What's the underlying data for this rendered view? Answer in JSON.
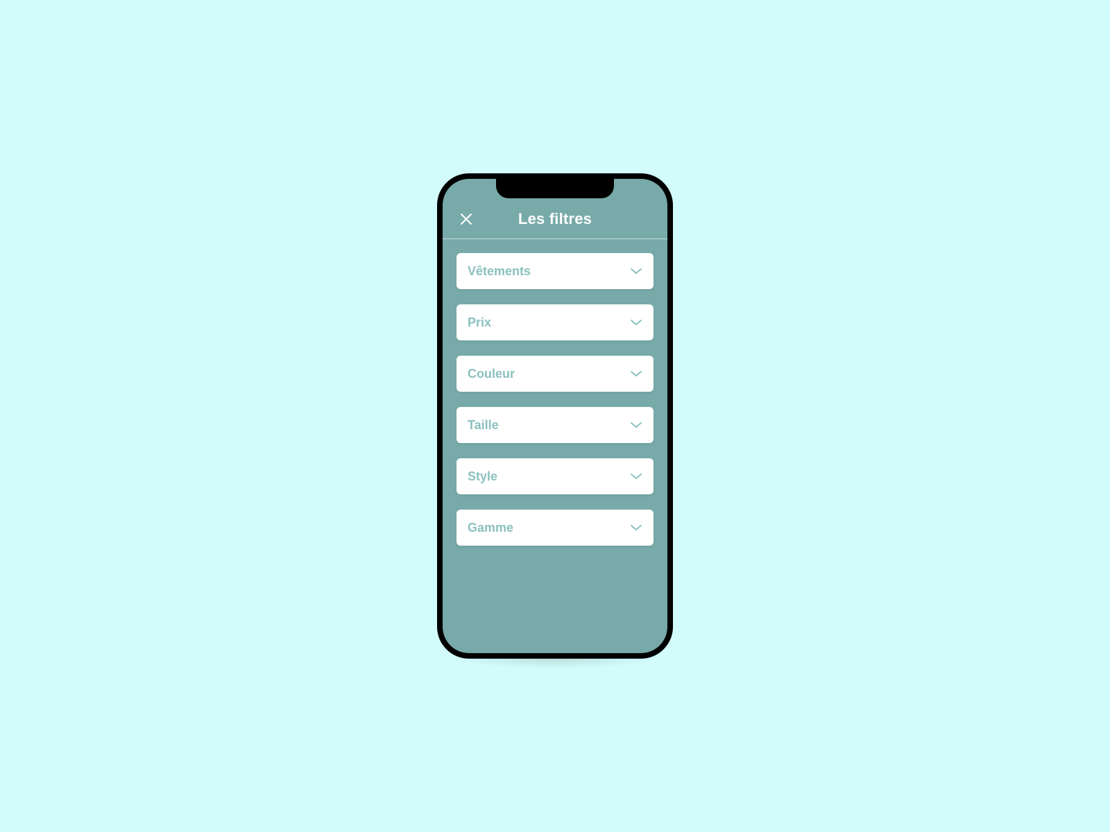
{
  "colors": {
    "page_bg": "#d2fbfb",
    "screen_bg": "#77aaa8",
    "card_bg": "#ffffff",
    "accent_text": "#8bc1bf",
    "title_text": "#ffffff"
  },
  "header": {
    "title": "Les filtres",
    "close_icon": "close-icon"
  },
  "filters": [
    {
      "label": "Vêtements"
    },
    {
      "label": "Prix"
    },
    {
      "label": "Couleur"
    },
    {
      "label": "Taille"
    },
    {
      "label": "Style"
    },
    {
      "label": "Gamme"
    }
  ]
}
